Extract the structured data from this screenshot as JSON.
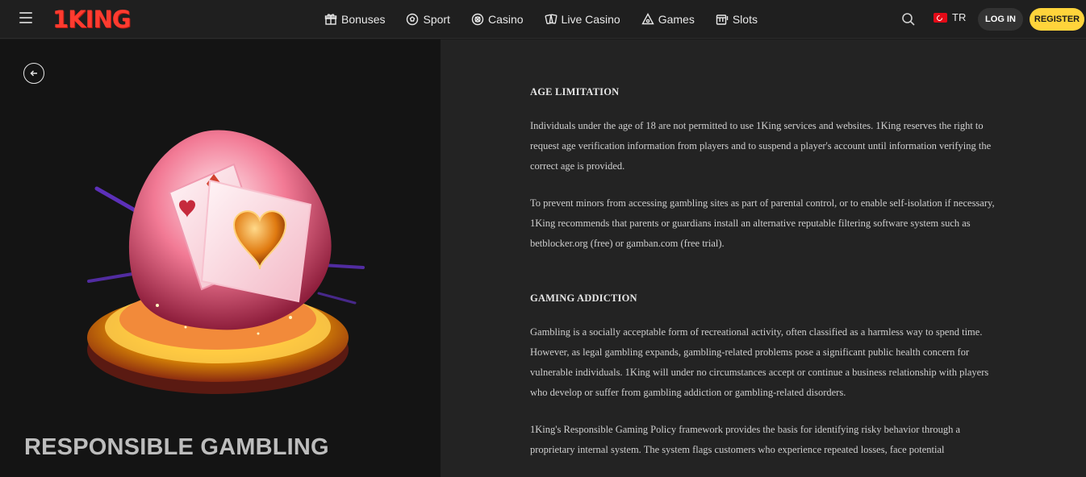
{
  "header": {
    "logo": "1KING",
    "nav": [
      {
        "label": "Bonuses",
        "icon": "gift-icon"
      },
      {
        "label": "Sport",
        "icon": "soccer-ball-icon"
      },
      {
        "label": "Casino",
        "icon": "casino-chip-icon"
      },
      {
        "label": "Live Casino",
        "icon": "cards-icon"
      },
      {
        "label": "Games",
        "icon": "games-icon"
      },
      {
        "label": "Slots",
        "icon": "slot-machine-icon"
      }
    ],
    "language": "TR",
    "login": "LOG IN",
    "register": "REGISTER"
  },
  "left": {
    "title": "RESPONSIBLE GAMBLING"
  },
  "content": {
    "section1": {
      "heading": "AGE LIMITATION",
      "p1": "Individuals under the age of 18 are not permitted to use 1King services and websites. 1King reserves the right to request age verification information from players and to suspend a player's account until information verifying the correct age is provided.",
      "p2": "To prevent minors from accessing gambling sites as part of parental control, or to enable self-isolation if necessary, 1King recommends that parents or guardians install an alternative reputable filtering software system such as betblocker.org (free) or gamban.com (free trial)."
    },
    "section2": {
      "heading": "GAMING ADDICTION",
      "p1": "Gambling is a socially acceptable form of recreational activity, often classified as a harmless way to spend time. However, as legal gambling expands, gambling-related problems pose a significant public health concern for vulnerable individuals. 1King will under no circumstances accept or continue a business relationship with players who develop or suffer from gambling addiction or gambling-related disorders.",
      "p2": "1King's Responsible Gaming Policy framework provides the basis for identifying risky behavior through a proprietary internal system. The system flags customers who experience repeated losses, face potential"
    }
  },
  "colors": {
    "accent_register": "#ffd43b",
    "logo": "#ff3b2f"
  }
}
